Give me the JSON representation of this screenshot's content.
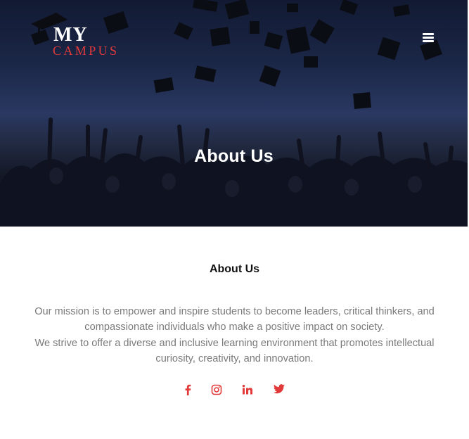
{
  "brand": {
    "line1": "MY",
    "line2": "CAMPUS",
    "accent_color": "#e23a3a"
  },
  "header": {
    "menu_icon": "hamburger-menu-icon"
  },
  "hero": {
    "title": "About Us"
  },
  "about": {
    "heading": "About Us",
    "paragraph1": "Our mission is to empower and inspire students to become leaders, critical thinkers, and compassionate individuals who make a positive impact on society.",
    "paragraph2": "We strive to offer a diverse and inclusive learning environment that promotes intellectual curiosity, creativity, and innovation."
  },
  "social_links": [
    {
      "name": "facebook",
      "icon": "facebook-icon"
    },
    {
      "name": "instagram",
      "icon": "instagram-icon"
    },
    {
      "name": "linkedin",
      "icon": "linkedin-icon"
    },
    {
      "name": "twitter",
      "icon": "twitter-icon"
    }
  ],
  "colors": {
    "text_muted": "#7a7a7a",
    "heading": "#111111",
    "hero_overlay": "#1b2747"
  }
}
